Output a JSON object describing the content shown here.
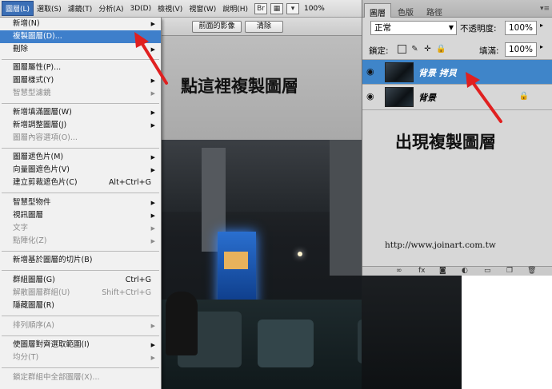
{
  "menubar": {
    "items": [
      "圖層(L)",
      "選取(S)",
      "濾鏡(T)",
      "分析(A)",
      "3D(D)",
      "檢視(V)",
      "視窗(W)",
      "說明(H)"
    ],
    "icons": [
      "ps-bridge-icon",
      "mini-bridge-icon",
      "arrange-icon"
    ],
    "zoom": "100%"
  },
  "optbar": {
    "button1": "前面的影像",
    "button2": "清除"
  },
  "layer_menu": {
    "items": [
      {
        "label": "新增(N)",
        "submenu": true,
        "disabled": false
      },
      {
        "label": "複製圖層(D)...",
        "submenu": false,
        "disabled": false,
        "highlighted": true
      },
      {
        "label": "刪除",
        "submenu": true,
        "disabled": false
      },
      {
        "label": "圖層屬性(P)...",
        "submenu": false,
        "disabled": false
      },
      {
        "label": "圖層樣式(Y)",
        "submenu": true,
        "disabled": false
      },
      {
        "label": "智慧型濾鏡",
        "submenu": true,
        "disabled": true
      },
      {
        "label": "新增填滿圖層(W)",
        "submenu": true,
        "disabled": false
      },
      {
        "label": "新增調整圖層(J)",
        "submenu": true,
        "disabled": false
      },
      {
        "label": "圖層內容選項(O)...",
        "submenu": false,
        "disabled": true
      },
      {
        "label": "圖層遮色片(M)",
        "submenu": true,
        "disabled": false
      },
      {
        "label": "向量圖遮色片(V)",
        "submenu": true,
        "disabled": false
      },
      {
        "label": "建立剪裁遮色片(C)",
        "shortcut": "Alt+Ctrl+G",
        "submenu": false,
        "disabled": false
      },
      {
        "label": "智慧型物件",
        "submenu": true,
        "disabled": false
      },
      {
        "label": "視訊圖層",
        "submenu": true,
        "disabled": false
      },
      {
        "label": "文字",
        "submenu": true,
        "disabled": true
      },
      {
        "label": "點陣化(Z)",
        "submenu": true,
        "disabled": true
      },
      {
        "label": "新增基於圖層的切片(B)",
        "submenu": false,
        "disabled": false
      },
      {
        "label": "群組圖層(G)",
        "shortcut": "Ctrl+G",
        "submenu": false,
        "disabled": false
      },
      {
        "label": "解散圖層群組(U)",
        "shortcut": "Shift+Ctrl+G",
        "submenu": false,
        "disabled": true
      },
      {
        "label": "隱藏圖層(R)",
        "submenu": false,
        "disabled": false
      },
      {
        "label": "排列順序(A)",
        "submenu": true,
        "disabled": true
      },
      {
        "label": "使圖層對齊選取範圍(I)",
        "submenu": true,
        "disabled": false
      },
      {
        "label": "均分(T)",
        "submenu": true,
        "disabled": true
      },
      {
        "label": "鎖定群組中全部圖層(X)...",
        "submenu": false,
        "disabled": true
      }
    ]
  },
  "annotations": {
    "callout_menu": "點這裡複製圖層",
    "callout_panel": "出現複製圖層",
    "watermark": "http://www.joinart.com.tw",
    "arrow_color": "#e02020"
  },
  "layers_panel": {
    "tabs": [
      "圖層",
      "色版",
      "路徑"
    ],
    "blend_mode": "正常",
    "opacity_label": "不透明度:",
    "opacity_value": "100%",
    "lock_label": "鎖定:",
    "fill_label": "填滿:",
    "fill_value": "100%",
    "layers": [
      {
        "name": "背景 拷貝",
        "selected": true,
        "visible": true,
        "locked": false
      },
      {
        "name": "背景",
        "selected": false,
        "visible": true,
        "locked": true
      }
    ]
  },
  "colors": {
    "highlight": "#3e7fcb",
    "selected_layer": "#3f85c9"
  }
}
